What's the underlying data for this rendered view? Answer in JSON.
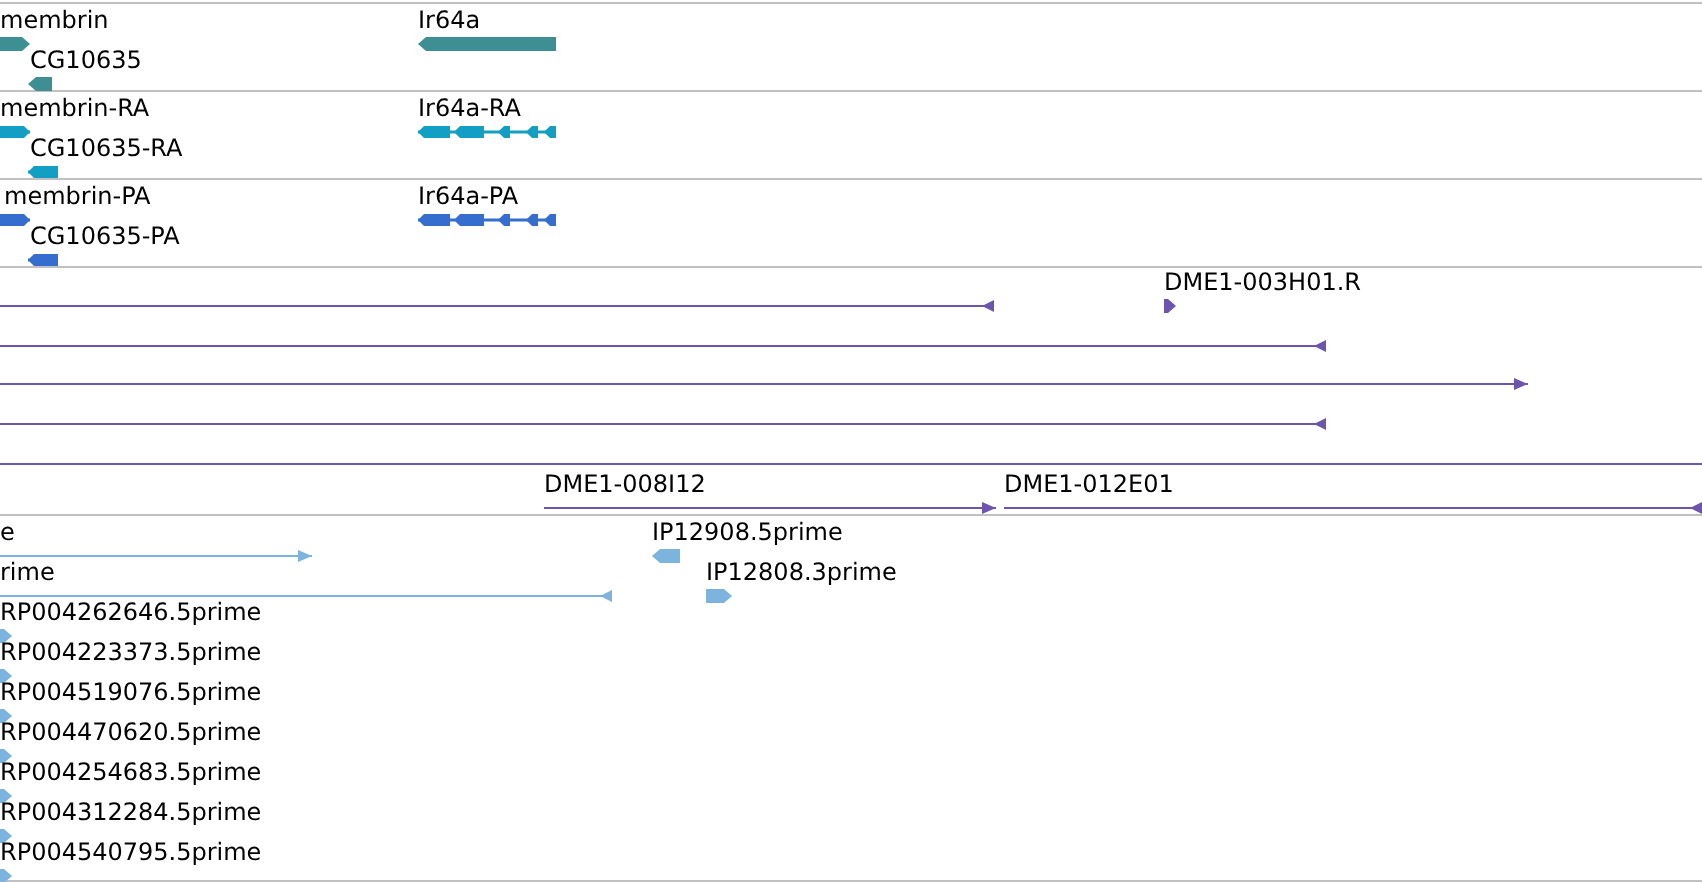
{
  "tracks": [
    {
      "color": "#3d8f93",
      "features": [
        {
          "label": "membrin",
          "kind": "block",
          "forward": true
        },
        {
          "label": "CG10635",
          "kind": "block",
          "forward": false
        },
        {
          "label": "Ir64a",
          "kind": "block",
          "forward": false
        }
      ]
    },
    {
      "color": "#129fc3",
      "features": [
        {
          "label": "membrin-RA",
          "kind": "transcript",
          "forward": true
        },
        {
          "label": "CG10635-RA",
          "kind": "transcript",
          "forward": false
        },
        {
          "label": "Ir64a-RA",
          "kind": "transcript",
          "forward": false
        }
      ]
    },
    {
      "color": "#356ecf",
      "features": [
        {
          "label": "membrin-PA",
          "kind": "transcript",
          "forward": true
        },
        {
          "label": "CG10635-PA",
          "kind": "transcript",
          "forward": false
        },
        {
          "label": "Ir64a-PA",
          "kind": "transcript",
          "forward": false
        }
      ]
    },
    {
      "color": "#6d55ae",
      "features": [
        {
          "kind": "line",
          "forward": false
        },
        {
          "label": "DME1-003H01.R",
          "kind": "block",
          "forward": true
        },
        {
          "kind": "line",
          "forward": false
        },
        {
          "kind": "line",
          "forward": true
        },
        {
          "kind": "line",
          "forward": false
        },
        {
          "kind": "line"
        },
        {
          "label": "DME1-008I12",
          "kind": "line",
          "forward": true
        },
        {
          "label": "DME1-012E01",
          "kind": "line",
          "forward": false
        }
      ]
    },
    {
      "color": "#7db4de",
      "features": [
        {
          "label": "e",
          "kind": "line",
          "forward": true
        },
        {
          "label": "rime",
          "kind": "line",
          "forward": false
        },
        {
          "label": "IP12908.5prime",
          "kind": "block",
          "forward": false
        },
        {
          "label": "IP12808.3prime",
          "kind": "block",
          "forward": true
        },
        {
          "label": "RP004262646.5prime",
          "kind": "block",
          "forward": true
        },
        {
          "label": "RP004223373.5prime",
          "kind": "block",
          "forward": true
        },
        {
          "label": "RP004519076.5prime",
          "kind": "block",
          "forward": true
        },
        {
          "label": "RP004470620.5prime",
          "kind": "block",
          "forward": true
        },
        {
          "label": "RP004254683.5prime",
          "kind": "block",
          "forward": true
        },
        {
          "label": "RP004312284.5prime",
          "kind": "block",
          "forward": true
        },
        {
          "label": "RP004540795.5prime",
          "kind": "block",
          "forward": true
        }
      ]
    }
  ]
}
